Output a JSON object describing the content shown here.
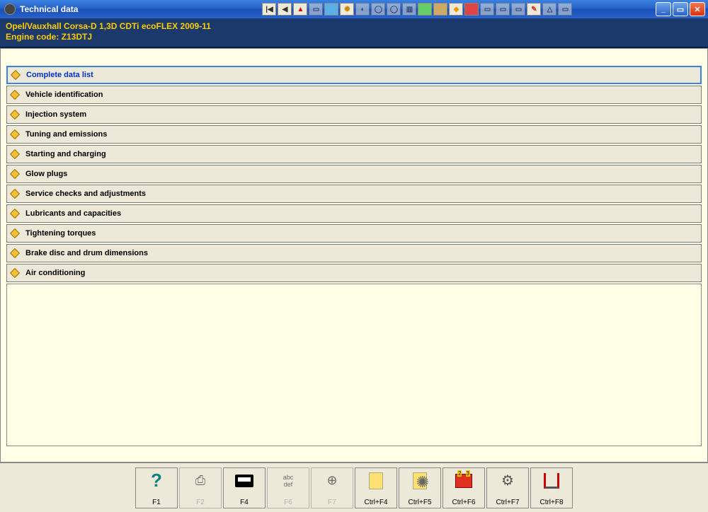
{
  "window": {
    "title": "Technical data"
  },
  "header": {
    "line1": "Opel/Vauxhall   Corsa-D  1,3D CDTi ecoFLEX 2009-11",
    "line2": "Engine code: Z13DTJ"
  },
  "items": [
    {
      "label": "Complete data list",
      "selected": true
    },
    {
      "label": "Vehicle identification",
      "selected": false
    },
    {
      "label": "Injection system",
      "selected": false
    },
    {
      "label": "Tuning and emissions",
      "selected": false
    },
    {
      "label": "Starting and charging",
      "selected": false
    },
    {
      "label": "Glow plugs",
      "selected": false
    },
    {
      "label": "Service checks and adjustments",
      "selected": false
    },
    {
      "label": "Lubricants and capacities",
      "selected": false
    },
    {
      "label": "Tightening torques",
      "selected": false
    },
    {
      "label": "Brake disc and drum dimensions",
      "selected": false
    },
    {
      "label": "Air conditioning",
      "selected": false
    }
  ],
  "footer": [
    {
      "label": "F1",
      "enabled": true,
      "icon": "?"
    },
    {
      "label": "F2",
      "enabled": false,
      "icon": "printer"
    },
    {
      "label": "F4",
      "enabled": true,
      "icon": "card"
    },
    {
      "label": "F6",
      "enabled": false,
      "icon": "abc"
    },
    {
      "label": "F7",
      "enabled": false,
      "icon": "target"
    },
    {
      "label": "Ctrl+F4",
      "enabled": true,
      "icon": "page-yellow"
    },
    {
      "label": "Ctrl+F5",
      "enabled": true,
      "icon": "page-gear"
    },
    {
      "label": "Ctrl+F6",
      "enabled": true,
      "icon": "fuse"
    },
    {
      "label": "Ctrl+F7",
      "enabled": true,
      "icon": "gears"
    },
    {
      "label": "Ctrl+F8",
      "enabled": true,
      "icon": "lift"
    }
  ],
  "toolbar_icons": [
    "first",
    "prev",
    "warning",
    "window",
    "image",
    "gear",
    "belt",
    "ring",
    "ring2",
    "doc",
    "green1",
    "green2",
    "diag",
    "red",
    "gray1",
    "gray2",
    "gray3",
    "paint",
    "tri",
    "gray4"
  ]
}
